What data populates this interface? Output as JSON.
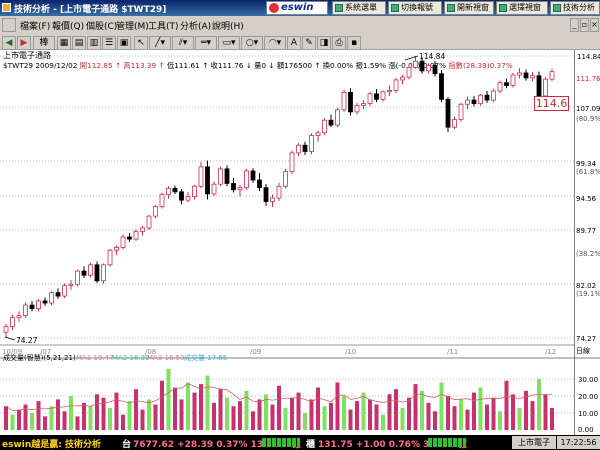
{
  "window": {
    "title": "技術分析 - [上市電子通路 $TWT29]"
  },
  "quick_buttons": [
    "系統選單",
    "切換報號",
    "開新視窗",
    "選擇視窗",
    "技術分析"
  ],
  "logo": "eswin",
  "menu": [
    "檔案(F)",
    "報價(Q)",
    "個股(C)",
    "管理(M)",
    "工具(T)",
    "分析(A)",
    "說明(H)"
  ],
  "toolbar": {
    "tool_labels": [
      "棒",
      "線",
      "A"
    ]
  },
  "chart_info": {
    "name": "上市電子通路",
    "symbol_date": "$TWT29 2009/12/02",
    "open": "開112.85 ↑",
    "high": "高113.39 ↑",
    "low": "低111.61 ↑",
    "close": "收111.76 ↓",
    "vol": "量0 ↓",
    "amount": "額176500 ↑",
    "turnover": "換0.00%",
    "amp": "振1.59%",
    "chg": "漲(-0.08)-0.07%",
    "index": "指數(28.39)0.37%"
  },
  "price_axis": {
    "labels": [
      "114.84",
      "111.76",
      "107.09",
      "(80.9%)",
      "99.34",
      "(61.8%)",
      "94.56",
      "89.77",
      "(38.2%)",
      "82.02",
      "(19.1%)",
      "74.27"
    ],
    "current_box": "114.6"
  },
  "annotations": {
    "high_label": "114.84",
    "low_label": "74.27"
  },
  "months": [
    "10/09",
    "/07",
    "/08",
    "/09",
    "/10",
    "/11",
    "/12"
  ],
  "volume_panel": {
    "title": "成交量(智慧)(5,21,21)",
    "ma1": "MA1 19.47",
    "ma2": "MA2 16.39",
    "ma3": "MA3 16.59",
    "vol_label": "成交量 17.65",
    "axis_labels": [
      "30.00",
      "20.00",
      "10.00",
      "0.00"
    ],
    "corner_label": "日線"
  },
  "status": {
    "brand": "eswin越是贏: 技術分析",
    "twse_label": "台",
    "twse": "7677.62 +28.39 0.37% 1390.83億",
    "otc_label": "櫃",
    "otc": "131.75 +1.00 0.76% 366.32億",
    "right_label": "上市電子",
    "time": "17:22:56"
  },
  "colors": {
    "up": "#c8305a",
    "down": "#000000",
    "vol_up": "#c8306e",
    "vol_down": "#80e060"
  },
  "chart_data": {
    "type": "candlestick",
    "ylim": [
      74.27,
      114.84
    ],
    "candles": [
      [
        75.1,
        76.3,
        74.3,
        75.9
      ],
      [
        75.9,
        77.6,
        75.4,
        77.2
      ],
      [
        77.2,
        78.1,
        76.6,
        77.5
      ],
      [
        77.5,
        79.4,
        77.2,
        79.0
      ],
      [
        79.0,
        79.6,
        78.1,
        78.5
      ],
      [
        78.5,
        79.9,
        78.1,
        79.6
      ],
      [
        79.6,
        80.1,
        78.9,
        79.3
      ],
      [
        79.3,
        81.0,
        79.0,
        80.8
      ],
      [
        80.8,
        81.4,
        79.9,
        80.3
      ],
      [
        80.3,
        82.1,
        80.0,
        81.8
      ],
      [
        81.8,
        82.6,
        81.2,
        82.0
      ],
      [
        82.0,
        84.1,
        81.7,
        83.9
      ],
      [
        83.9,
        84.6,
        82.9,
        83.3
      ],
      [
        83.3,
        85.1,
        83.0,
        84.8
      ],
      [
        84.8,
        85.3,
        82.2,
        82.5
      ],
      [
        82.5,
        85.0,
        82.1,
        84.8
      ],
      [
        84.8,
        87.1,
        84.5,
        86.9
      ],
      [
        86.9,
        87.6,
        86.2,
        87.3
      ],
      [
        87.3,
        89.2,
        87.0,
        88.8
      ],
      [
        88.8,
        89.4,
        88.1,
        88.5
      ],
      [
        88.5,
        89.9,
        88.2,
        89.6
      ],
      [
        89.6,
        90.4,
        89.0,
        90.1
      ],
      [
        90.1,
        92.0,
        89.8,
        91.8
      ],
      [
        91.8,
        93.4,
        91.5,
        93.2
      ],
      [
        93.2,
        95.2,
        92.9,
        94.9
      ],
      [
        94.9,
        96.1,
        94.3,
        95.8
      ],
      [
        95.8,
        96.2,
        95.0,
        95.3
      ],
      [
        95.3,
        95.7,
        93.5,
        94.1
      ],
      [
        94.1,
        95.3,
        93.8,
        94.6
      ],
      [
        94.6,
        96.3,
        94.2,
        96.1
      ],
      [
        96.1,
        99.6,
        95.8,
        98.9
      ],
      [
        98.9,
        99.8,
        94.2,
        95.0
      ],
      [
        95.0,
        96.8,
        94.7,
        96.4
      ],
      [
        96.4,
        98.9,
        96.1,
        98.6
      ],
      [
        98.6,
        99.1,
        96.1,
        96.5
      ],
      [
        96.5,
        97.3,
        95.2,
        95.6
      ],
      [
        95.6,
        96.3,
        94.6,
        95.9
      ],
      [
        95.9,
        98.6,
        95.6,
        98.3
      ],
      [
        98.3,
        98.7,
        96.6,
        97.0
      ],
      [
        97.0,
        98.0,
        95.4,
        95.9
      ],
      [
        95.9,
        96.4,
        93.3,
        93.9
      ],
      [
        93.9,
        94.9,
        93.1,
        94.4
      ],
      [
        94.4,
        96.6,
        94.0,
        96.1
      ],
      [
        96.1,
        98.6,
        95.8,
        98.2
      ],
      [
        98.2,
        101.2,
        97.9,
        100.9
      ],
      [
        100.9,
        102.3,
        100.4,
        102.0
      ],
      [
        102.0,
        102.5,
        100.6,
        101.1
      ],
      [
        101.1,
        103.7,
        100.7,
        103.4
      ],
      [
        103.4,
        104.1,
        102.5,
        103.8
      ],
      [
        103.8,
        105.9,
        103.5,
        105.6
      ],
      [
        105.6,
        106.4,
        104.6,
        104.9
      ],
      [
        104.9,
        107.4,
        104.6,
        107.1
      ],
      [
        107.1,
        110.0,
        106.8,
        109.6
      ],
      [
        109.6,
        110.2,
        106.3,
        106.8
      ],
      [
        106.8,
        108.1,
        106.4,
        107.7
      ],
      [
        107.7,
        108.5,
        107.2,
        108.0
      ],
      [
        108.0,
        109.7,
        107.6,
        109.4
      ],
      [
        109.4,
        110.1,
        108.2,
        108.6
      ],
      [
        108.6,
        109.9,
        108.3,
        109.7
      ],
      [
        109.7,
        110.6,
        109.1,
        109.9
      ],
      [
        109.9,
        111.7,
        109.5,
        111.4
      ],
      [
        111.4,
        112.1,
        110.8,
        111.8
      ],
      [
        111.8,
        113.5,
        111.5,
        113.2
      ],
      [
        113.2,
        114.84,
        113.0,
        114.1
      ],
      [
        114.1,
        114.6,
        112.3,
        112.7
      ],
      [
        112.7,
        113.8,
        112.4,
        113.5
      ],
      [
        113.5,
        114.1,
        111.9,
        112.3
      ],
      [
        112.3,
        112.8,
        108.2,
        108.6
      ],
      [
        108.6,
        108.9,
        103.9,
        104.6
      ],
      [
        104.6,
        106.1,
        104.3,
        105.7
      ],
      [
        105.7,
        108.1,
        105.4,
        107.9
      ],
      [
        107.9,
        109.0,
        107.2,
        108.5
      ],
      [
        108.5,
        109.1,
        107.6,
        108.0
      ],
      [
        108.0,
        109.4,
        107.7,
        109.2
      ],
      [
        109.2,
        109.8,
        108.1,
        108.5
      ],
      [
        108.5,
        110.1,
        108.2,
        109.8
      ],
      [
        109.8,
        111.3,
        109.5,
        111.0
      ],
      [
        111.0,
        111.6,
        110.2,
        110.6
      ],
      [
        110.6,
        112.4,
        110.3,
        112.1
      ],
      [
        112.1,
        113.1,
        111.6,
        112.4
      ],
      [
        112.4,
        112.9,
        111.3,
        111.7
      ],
      [
        111.7,
        112.5,
        111.2,
        112.0
      ],
      [
        112.0,
        112.6,
        108.8,
        109.1
      ],
      [
        109.1,
        111.8,
        108.8,
        111.5
      ],
      [
        111.5,
        113.0,
        111.2,
        112.6
      ]
    ],
    "volumes": [
      14,
      9,
      12,
      15,
      10,
      17,
      8,
      14,
      18,
      11,
      20,
      8,
      16,
      14,
      21,
      19,
      13,
      22,
      9,
      17,
      24,
      12,
      18,
      15,
      29,
      36,
      25,
      18,
      28,
      22,
      27,
      32,
      16,
      24,
      19,
      14,
      17,
      23,
      11,
      18,
      21,
      15,
      26,
      13,
      19,
      22,
      10,
      18,
      25,
      14,
      16,
      28,
      20,
      12,
      17,
      22,
      18,
      15,
      9,
      21,
      24,
      13,
      19,
      27,
      23,
      16,
      11,
      28,
      20,
      14,
      18,
      12,
      22,
      25,
      15,
      19,
      11,
      29,
      21,
      13,
      23,
      17,
      30,
      21,
      13
    ]
  }
}
